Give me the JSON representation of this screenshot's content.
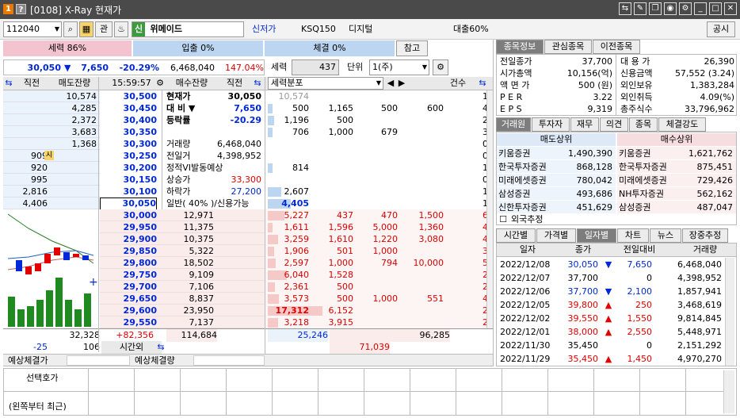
{
  "title": {
    "badge1": "1",
    "badge2": "?",
    "text": "[0108] X-Ray 현재가"
  },
  "toolbar": {
    "code": "112040",
    "gwan": "관",
    "shin": "신",
    "name": "위메이드",
    "newlow": "신저가",
    "index": "KSQ150",
    "sector": "디지털",
    "loan": "대출60%",
    "notice": "공시"
  },
  "power": {
    "label": "세력 86%",
    "flow": "입출 0%",
    "deal": "체결 0%",
    "ref": "참고"
  },
  "price": {
    "cur": "30,050",
    "arrow": "▼",
    "chg": "7,650",
    "pct": "-20.29%",
    "vol": "6,468,040",
    "volpct": "147.04%"
  },
  "filter": {
    "label": "세력",
    "value": "437",
    "unit_label": "단위",
    "unit": "1(주)"
  },
  "ob_head": {
    "c1": "직전",
    "c2": "매도잔량",
    "time": "15:59:57",
    "c3": "매수잔량",
    "c4": "직전",
    "c5": "세력분포",
    "c6": "건수"
  },
  "asks": [
    {
      "qty": "10,574",
      "price": "30,500",
      "lbl": "현재가",
      "val": "30,050",
      "d": [
        "10,574",
        "",
        "",
        ""
      ],
      "cnt": "1"
    },
    {
      "qty": "4,285",
      "price": "30,450",
      "lbl": "대 비 ▼",
      "val": "7,650",
      "d": [
        "500",
        "1,165",
        "500",
        "600"
      ],
      "cnt": "4"
    },
    {
      "qty": "2,372",
      "price": "30,400",
      "lbl": "등락률",
      "val": "-20.29",
      "d": [
        "1,196",
        "500",
        "",
        ""
      ],
      "cnt": "2"
    },
    {
      "qty": "3,683",
      "price": "30,350",
      "lbl": "",
      "val": "",
      "d": [
        "706",
        "1,000",
        "679",
        ""
      ],
      "cnt": "3"
    },
    {
      "qty": "1,368",
      "price": "30,300",
      "lbl": "거래량",
      "val": "6,468,040",
      "d": [
        "",
        "",
        "",
        ""
      ],
      "cnt": "0"
    },
    {
      "prev": "909",
      "qty": "",
      "price": "30,250",
      "lbl": "전일거",
      "val": "4,398,952",
      "d": [
        "",
        "",
        "",
        ""
      ],
      "cnt": "0"
    },
    {
      "prev": "920",
      "qty": "",
      "price": "30,200",
      "lbl": "정적VI발동예상",
      "val": "",
      "d": [
        "814",
        "",
        "",
        ""
      ],
      "cnt": "1"
    },
    {
      "prev": "995",
      "qty": "",
      "price": "30,150",
      "lbl": "상승가",
      "val": "33,300",
      "d": [
        "",
        "",
        "",
        ""
      ],
      "cnt": "0"
    },
    {
      "prev": "2,816",
      "qty": "",
      "price": "30,100",
      "lbl": "하락가",
      "val": "27,200",
      "d": [
        "2,607",
        "",
        "",
        ""
      ],
      "cnt": "1"
    },
    {
      "prev": "4,406",
      "qty": "",
      "price": "30,050",
      "lbl": "일반( 40% )/신용가능",
      "val": "",
      "d": [
        "4,405",
        "",
        "",
        ""
      ],
      "cnt": "1"
    }
  ],
  "bids": [
    {
      "price": "30,000",
      "qty": "12,971",
      "d": [
        "5,227",
        "437",
        "470",
        "1,500"
      ],
      "cnt": "6"
    },
    {
      "price": "29,950",
      "qty": "11,375",
      "d": [
        "1,611",
        "1,596",
        "5,000",
        "1,360"
      ],
      "cnt": "4"
    },
    {
      "price": "29,900",
      "qty": "10,375",
      "d": [
        "3,259",
        "1,610",
        "1,220",
        "3,080"
      ],
      "cnt": "4"
    },
    {
      "price": "29,850",
      "qty": "5,322",
      "d": [
        "1,906",
        "501",
        "1,000",
        ""
      ],
      "cnt": "3"
    },
    {
      "price": "29,800",
      "qty": "18,502",
      "d": [
        "2,597",
        "1,000",
        "794",
        "10,000"
      ],
      "cnt": "5"
    },
    {
      "price": "29,750",
      "qty": "9,109",
      "d": [
        "6,040",
        "1,528",
        "",
        ""
      ],
      "cnt": "2"
    },
    {
      "price": "29,700",
      "qty": "7,106",
      "d": [
        "2,361",
        "500",
        "",
        ""
      ],
      "cnt": "2"
    },
    {
      "price": "29,650",
      "qty": "8,837",
      "d": [
        "3,573",
        "500",
        "1,000",
        "551"
      ],
      "cnt": "4"
    },
    {
      "price": "29,600",
      "qty": "23,950",
      "d": [
        "17,312",
        "6,152",
        "",
        ""
      ],
      "cnt": "2"
    },
    {
      "price": "29,550",
      "qty": "7,137",
      "d": [
        "3,218",
        "3,915",
        "",
        ""
      ],
      "cnt": "2"
    }
  ],
  "totals": {
    "ask": "32,328",
    "chg": "+82,356",
    "bid": "114,684",
    "sum1": "25,246",
    "sum2": "96,285",
    "a2": "-25",
    "b2": "106",
    "after": "시간외",
    "sum3": "71,039"
  },
  "expect": {
    "a": "예상체결가",
    "b": "예상체결량"
  },
  "bottom": {
    "l1": "선택호가",
    "l2": "(왼쪽부터 최근)"
  },
  "info_tabs": [
    "종목정보",
    "관심종목",
    "이전종목"
  ],
  "info": [
    [
      "전일종가",
      "37,700",
      "대 용 가",
      "26,390"
    ],
    [
      "시가총액",
      "10,156(억)",
      "신용금액",
      "57,552 (3.24)"
    ],
    [
      "액 면 가",
      "500 (원)",
      "외인보유",
      "1,383,284"
    ],
    [
      "P E R",
      "3.22",
      "외인취득",
      "4.09(%)"
    ],
    [
      "E P S",
      "9,319",
      "총주식수",
      "33,796,962"
    ]
  ],
  "broker_tabs": [
    "거래원",
    "투자자",
    "재무",
    "의견",
    "종목",
    "체결강도"
  ],
  "broker_head": {
    "sell": "매도상위",
    "buy": "매수상위"
  },
  "brokers": [
    [
      "키움증권",
      "1,490,390",
      "키움증권",
      "1,621,762"
    ],
    [
      "한국투자증권",
      "868,128",
      "한국투자증권",
      "875,451"
    ],
    [
      "미래에셋증권",
      "780,042",
      "미래에셋증권",
      "729,426"
    ],
    [
      "삼성증권",
      "493,686",
      "NH투자증권",
      "562,162"
    ],
    [
      "신한투자증권",
      "451,629",
      "삼성증권",
      "487,047"
    ]
  ],
  "foreign": "외국추정",
  "daily_tabs": [
    "시간별",
    "가격별",
    "일자별",
    "차트",
    "뉴스",
    "장중추정"
  ],
  "daily_head": [
    "일자",
    "종가",
    "전일대비",
    "거래량"
  ],
  "daily": [
    {
      "date": "2022/12/08",
      "close": "30,050",
      "sign": "▼",
      "chg": "7,650",
      "vol": "6,468,040",
      "t": "d"
    },
    {
      "date": "2022/12/07",
      "close": "37,700",
      "sign": "",
      "chg": "0",
      "vol": "4,398,952",
      "t": "n"
    },
    {
      "date": "2022/12/06",
      "close": "37,700",
      "sign": "▼",
      "chg": "2,100",
      "vol": "1,857,941",
      "t": "d"
    },
    {
      "date": "2022/12/05",
      "close": "39,800",
      "sign": "▲",
      "chg": "250",
      "vol": "3,468,619",
      "t": "u"
    },
    {
      "date": "2022/12/02",
      "close": "39,550",
      "sign": "▲",
      "chg": "1,550",
      "vol": "9,814,845",
      "t": "u"
    },
    {
      "date": "2022/12/01",
      "close": "38,000",
      "sign": "▲",
      "chg": "2,550",
      "vol": "5,448,971",
      "t": "u"
    },
    {
      "date": "2022/11/30",
      "close": "35,450",
      "sign": "",
      "chg": "0",
      "vol": "2,151,292",
      "t": "n"
    },
    {
      "date": "2022/11/29",
      "close": "35,450",
      "sign": "▲",
      "chg": "1,450",
      "vol": "4,970,270",
      "t": "u"
    }
  ],
  "colors": {
    "up": "#e00000",
    "down": "#0028d8",
    "ask_bg": "#eaf2fb",
    "bid_bg": "#fbecec"
  }
}
